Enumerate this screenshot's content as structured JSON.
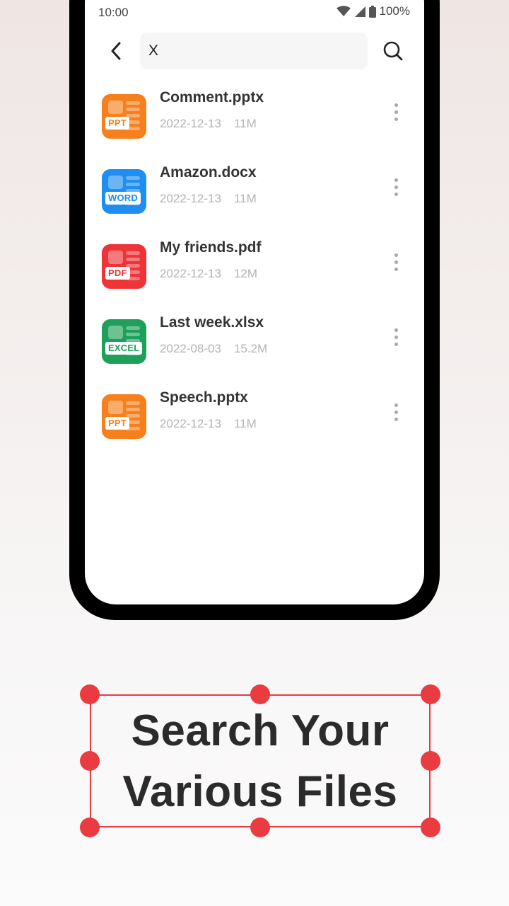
{
  "status_bar": {
    "time": "10:00",
    "battery": "100%",
    "icons": [
      "wifi-icon",
      "signal-icon",
      "battery-icon"
    ]
  },
  "search": {
    "query": "X",
    "back_icon": "chevron-left-icon",
    "search_icon": "search-icon"
  },
  "files": [
    {
      "name": "Comment.pptx",
      "date": "2022-12-13",
      "size": "11M",
      "type_label": "PPT",
      "color": "#f7801e",
      "tag_color": "#f7801e"
    },
    {
      "name": "Amazon.docx",
      "date": "2022-12-13",
      "size": "11M",
      "type_label": "WORD",
      "color": "#1e8ef0",
      "tag_color": "#1e8ef0"
    },
    {
      "name": "My friends.pdf",
      "date": "2022-12-13",
      "size": "12M",
      "type_label": "PDF",
      "color": "#ee3438",
      "tag_color": "#ee3438"
    },
    {
      "name": "Last week.xlsx",
      "date": "2022-08-03",
      "size": "15.2M",
      "type_label": "EXCEL",
      "color": "#1fa05a",
      "tag_color": "#1fa05a"
    },
    {
      "name": "Speech.pptx",
      "date": "2022-12-13",
      "size": "11M",
      "type_label": "PPT",
      "color": "#f7801e",
      "tag_color": "#f7801e"
    }
  ],
  "caption": {
    "line1": "Search Your",
    "line2": "Various Files",
    "accent": "#ea3b40"
  }
}
